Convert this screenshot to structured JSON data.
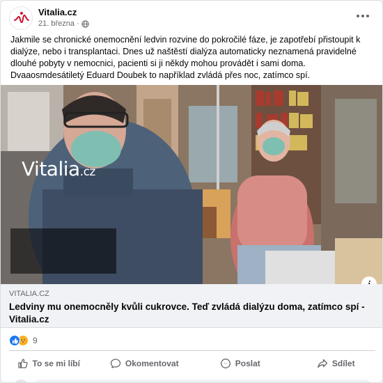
{
  "post": {
    "page_name": "Vitalia.cz",
    "date": "21. března",
    "privacy_icon": "globe-icon",
    "more_icon": "more-options-icon",
    "body": "Jakmile se chronické onemocnění ledvin rozvine do pokročilé fáze, je zapotřebí přistoupit k dialýze, nebo i transplantaci. Dnes už naštěstí dialýza automaticky neznamená pravidelné dlouhé pobyty v nemocnici, pacienti si ji někdy mohou provádět i sami doma. Dvaaosmdesátiletý Eduard Doubek to například zvládá přes noc, zatímco spí."
  },
  "image": {
    "watermark_main": "Vitalia",
    "watermark_suffix": ".cz",
    "info_icon": "info-icon"
  },
  "link": {
    "domain": "VITALIA.CZ",
    "headline": "Ledviny mu onemocněly kvůli cukrovce. Teď zvládá dialýzu doma, zatímco spí - Vitalia.cz"
  },
  "reactions": {
    "icons": [
      "like-reaction-icon",
      "care-reaction-icon"
    ],
    "count": "9"
  },
  "actions": {
    "like": "To se mi líbí",
    "comment": "Okomentovat",
    "send": "Poslat",
    "share": "Sdílet"
  },
  "colors": {
    "brand_red": "#c8102e",
    "like_blue": "#1877f2",
    "text_secondary": "#65676b"
  }
}
